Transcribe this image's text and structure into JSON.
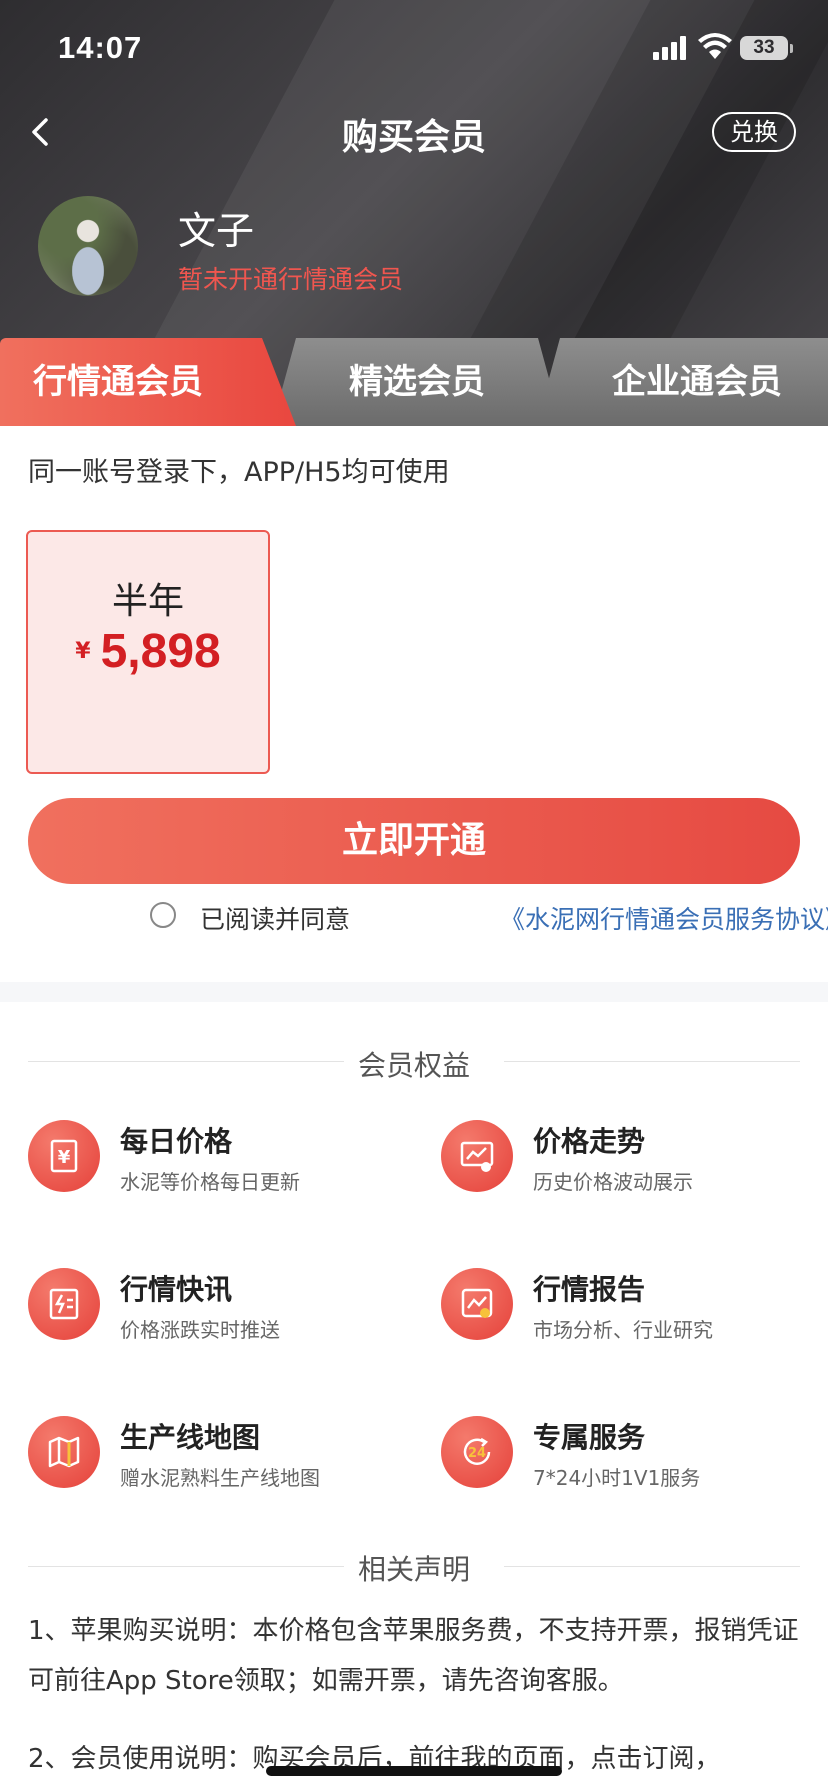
{
  "status_bar": {
    "time": "14:07",
    "battery": "33"
  },
  "header": {
    "title": "购买会员",
    "redeem_label": "兑换"
  },
  "user": {
    "name": "文子",
    "status": "暂未开通行情通会员"
  },
  "tabs": [
    {
      "label": "行情通会员",
      "active": true
    },
    {
      "label": "精选会员",
      "active": false
    },
    {
      "label": "企业通会员",
      "active": false
    }
  ],
  "description": "同一账号登录下，APP/H5均可使用",
  "plan": {
    "name": "半年",
    "currency": "¥",
    "price": "5,898"
  },
  "open_button": "立即开通",
  "agreement": {
    "text": "已阅读并同意",
    "link": "《水泥网行情通会员服务协议》"
  },
  "benefits_title": "会员权益",
  "benefits": [
    {
      "title": "每日价格",
      "subtitle": "水泥等价格每日更新",
      "icon": "daily-price-icon"
    },
    {
      "title": "价格走势",
      "subtitle": "历史价格波动展示",
      "icon": "price-trend-icon"
    },
    {
      "title": "行情快讯",
      "subtitle": "价格涨跌实时推送",
      "icon": "market-news-icon"
    },
    {
      "title": "行情报告",
      "subtitle": "市场分析、行业研究",
      "icon": "market-report-icon"
    },
    {
      "title": "生产线地图",
      "subtitle": "赠水泥熟料生产线地图",
      "icon": "map-icon"
    },
    {
      "title": "专属服务",
      "subtitle": "7*24小时1V1服务",
      "icon": "service-24-icon"
    }
  ],
  "notice_title": "相关声明",
  "notices": [
    "1、苹果购买说明：本价格包含苹果服务费，不支持开票，报销凭证可前往App Store领取；如需开票，请先咨询客服。",
    "2、会员使用说明：购买会员后，前往我的页面，点击订阅，"
  ],
  "colors": {
    "accent": "#e9473f",
    "price": "#d31f23",
    "link": "#3a6fb5",
    "header_bg": "#3a393c"
  }
}
